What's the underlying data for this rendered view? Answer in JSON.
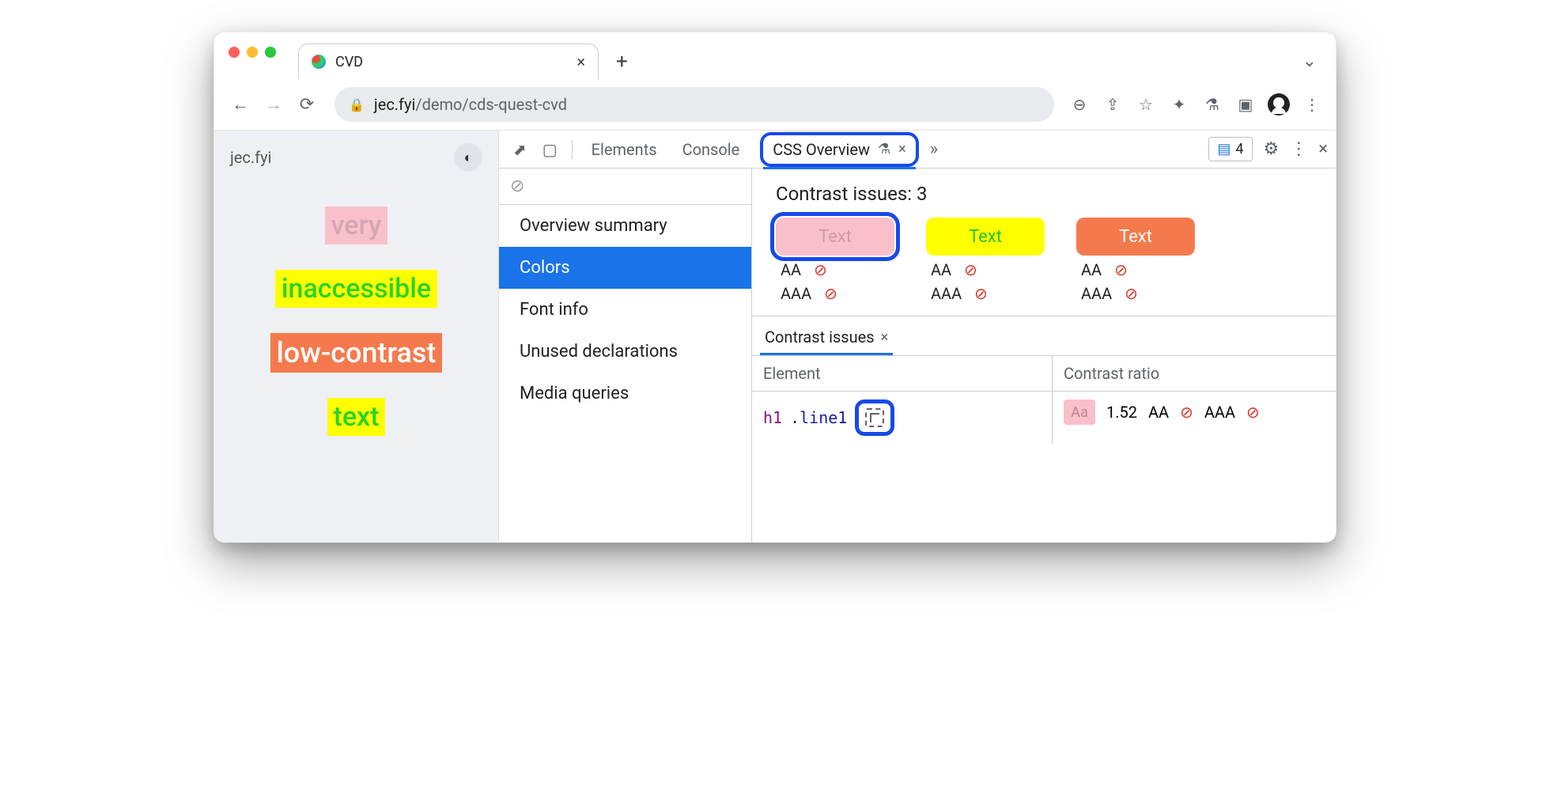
{
  "browser": {
    "tab_title": "CVD",
    "url_host": "jec.fyi",
    "url_path": "/demo/cds-quest-cvd"
  },
  "page": {
    "site_label": "jec.fyi",
    "lines": [
      "very",
      "inaccessible",
      "low-contrast",
      "text"
    ]
  },
  "devtools": {
    "tabs": {
      "elements": "Elements",
      "console": "Console",
      "css_overview": "CSS Overview"
    },
    "issue_count": "4",
    "nav": {
      "summary": "Overview summary",
      "colors": "Colors",
      "font": "Font info",
      "unused": "Unused declarations",
      "media": "Media queries"
    },
    "contrast": {
      "heading": "Contrast issues: 3",
      "swatch_label": "Text",
      "aa": "AA",
      "aaa": "AAA"
    },
    "drawer": {
      "tab": "Contrast issues",
      "col_element": "Element",
      "col_ratio": "Contrast ratio",
      "row_element_tag": "h1",
      "row_element_class": ".line1",
      "aa_badge": "Aa",
      "ratio": "1.52",
      "ratio_aa": "AA",
      "ratio_aaa": "AAA"
    }
  }
}
